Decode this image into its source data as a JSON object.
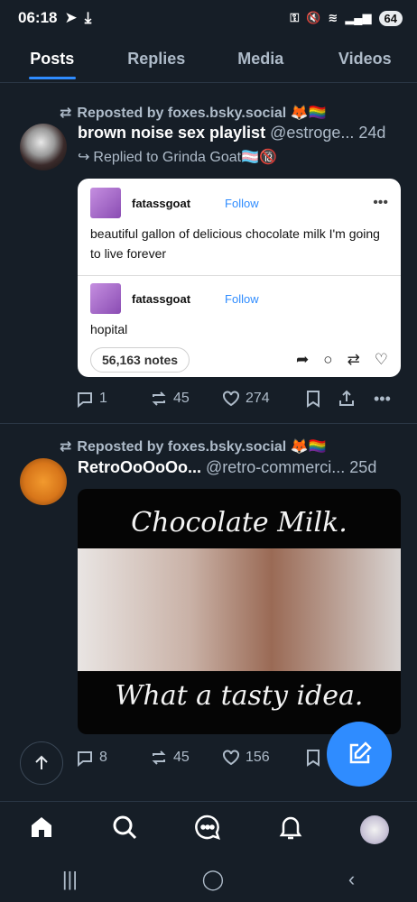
{
  "status": {
    "time": "06:18",
    "battery": "64"
  },
  "tabs": [
    "Posts",
    "Replies",
    "Media",
    "Videos"
  ],
  "posts": [
    {
      "repost_label": "Reposted by foxes.bsky.social 🦊🏳️‍🌈",
      "display_name": "brown noise sex playlist",
      "handle": "@estroge...",
      "time": "24d",
      "reply_to": "Replied to Grinda Goat🏳️‍⚧️🔞",
      "embed": {
        "post1_user": "fatassgoat",
        "post1_follow": "Follow",
        "post1_text": "beautiful gallon of delicious chocolate milk I'm going to live forever",
        "post2_user": "fatassgoat",
        "post2_follow": "Follow",
        "post2_text": "hopital",
        "notes": "56,163 notes"
      },
      "replies": "1",
      "reposts": "45",
      "likes": "274"
    },
    {
      "repost_label": "Reposted by foxes.bsky.social 🦊🏳️‍🌈",
      "display_name": "RetroOoOoOo...",
      "handle": "@retro-commerci...",
      "time": "25d",
      "video": {
        "top_text": "Chocolate Milk.",
        "bottom_text": "What a tasty idea."
      },
      "replies": "8",
      "reposts": "45",
      "likes": "156"
    }
  ],
  "icons": {
    "nav": [
      "home-icon",
      "search-icon",
      "chat-icon",
      "bell-icon",
      "profile-avatar"
    ],
    "accent": "#2f8cff"
  }
}
